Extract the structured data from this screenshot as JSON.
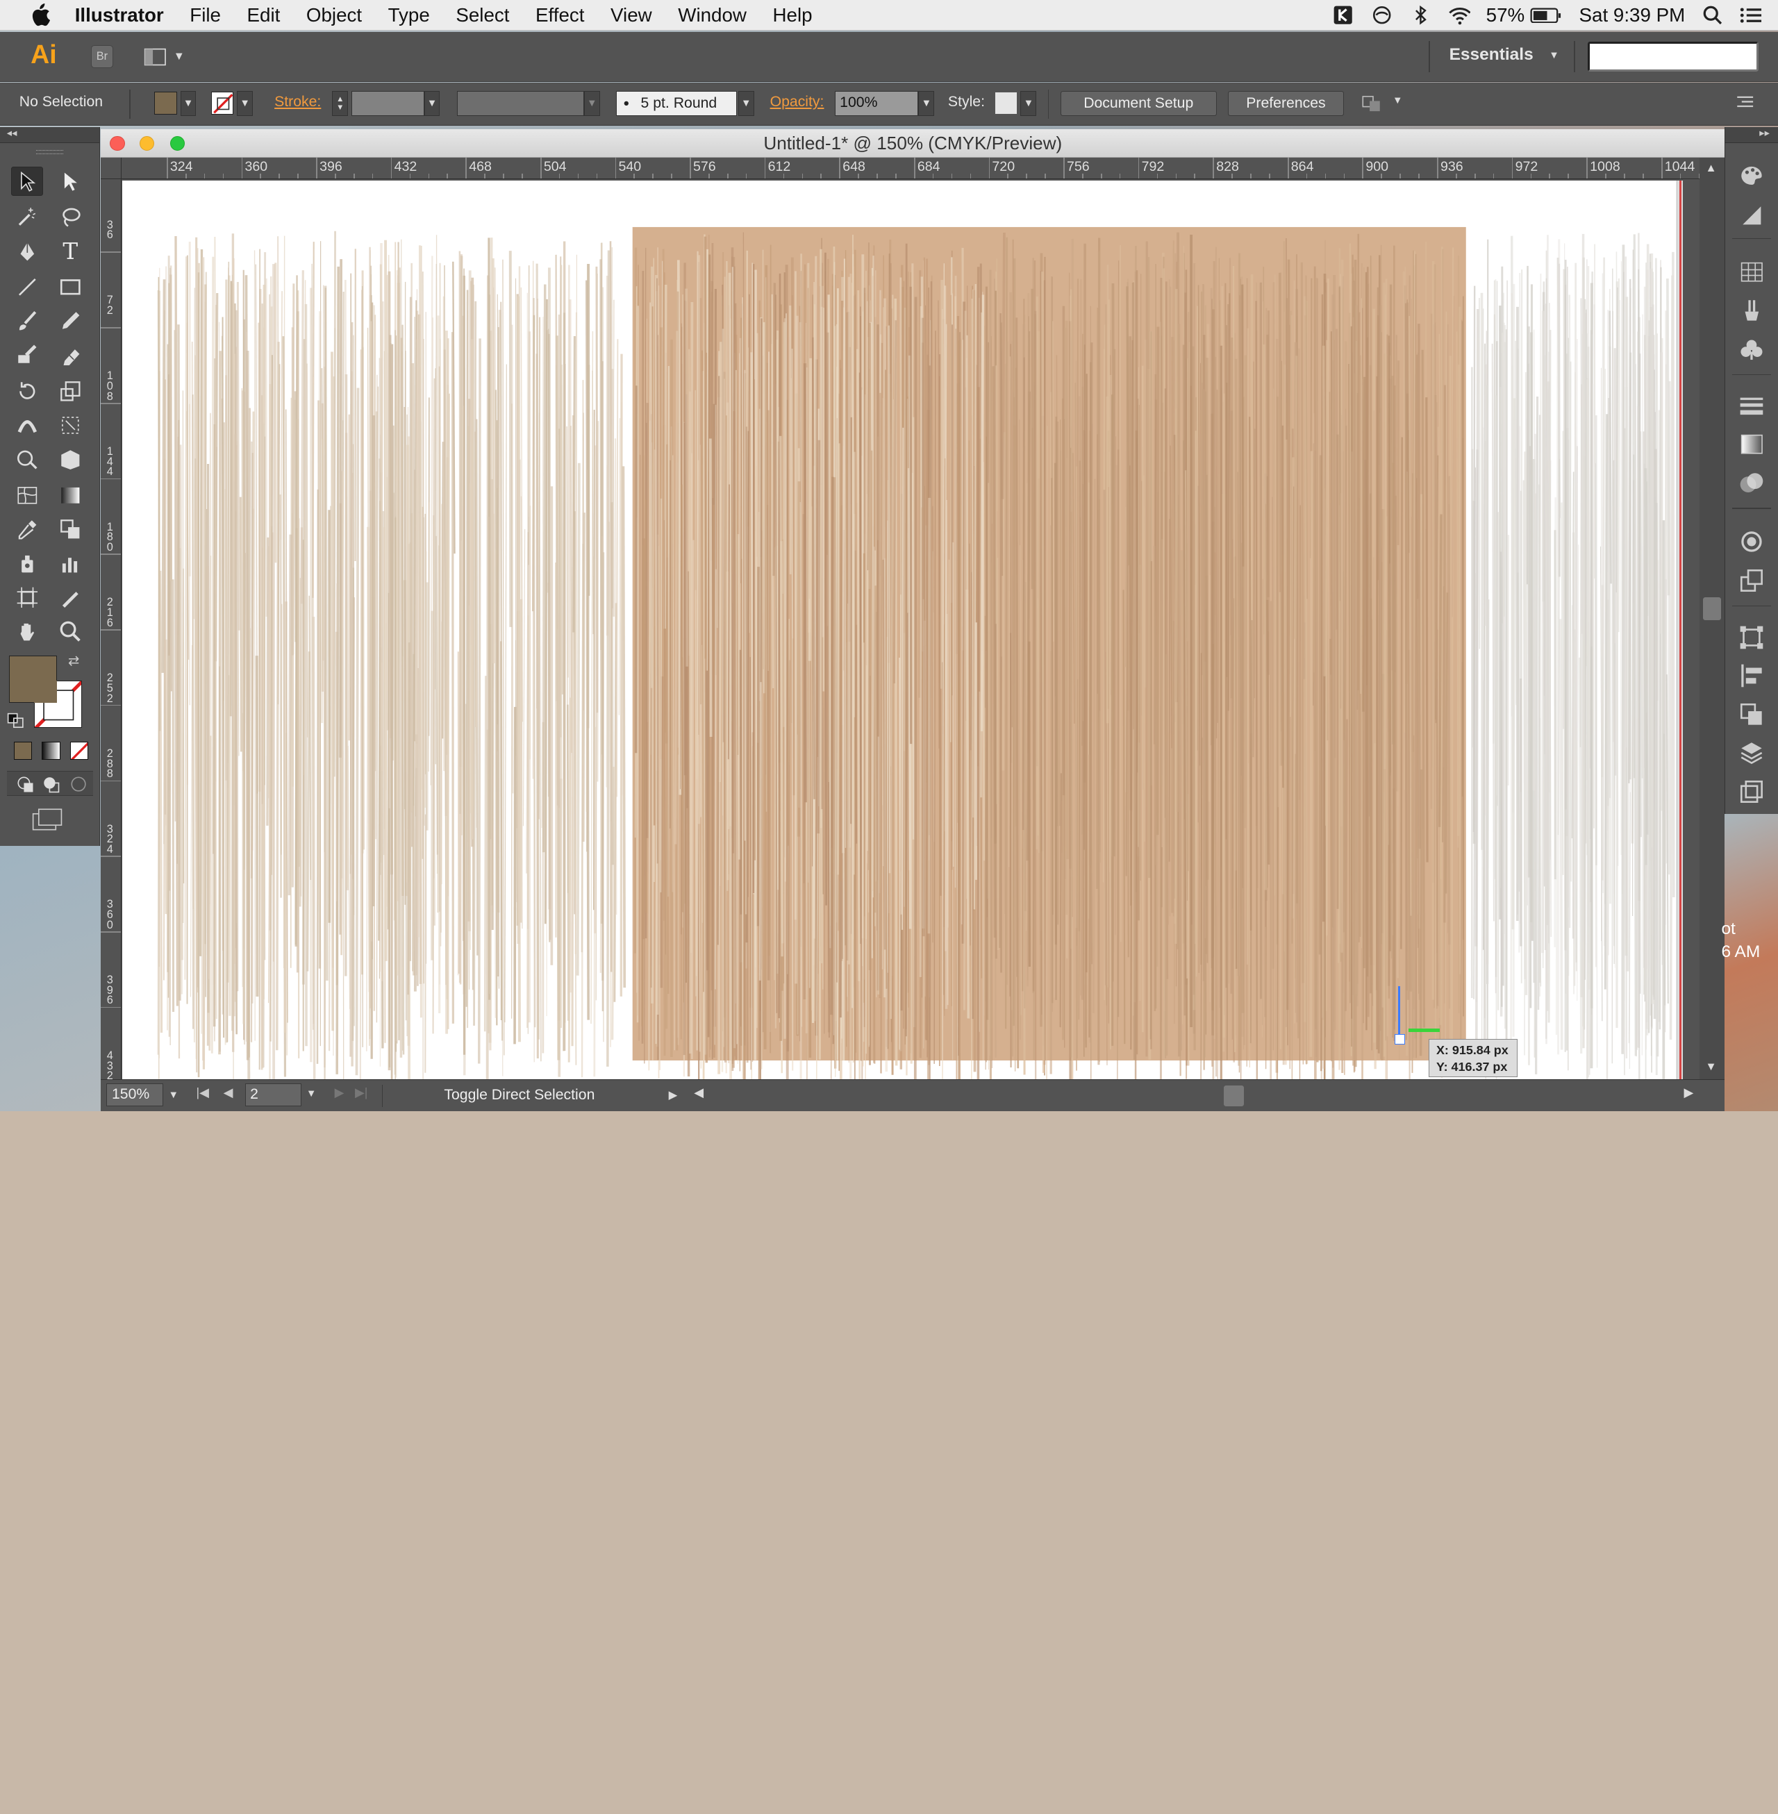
{
  "menubar": {
    "app_name": "Illustrator",
    "items": [
      "File",
      "Edit",
      "Object",
      "Type",
      "Select",
      "Effect",
      "View",
      "Window",
      "Help"
    ],
    "battery": "57%",
    "clock": "Sat 9:39 PM"
  },
  "appbar": {
    "logo": "Ai",
    "bridge": "Br",
    "workspace": "Essentials",
    "search_placeholder": ""
  },
  "control_bar": {
    "selection_status": "No Selection",
    "fill_color": "#7b6a4f",
    "stroke_label": "Stroke:",
    "brush_label": "5 pt. Round",
    "opacity_label": "Opacity:",
    "opacity_value": "100%",
    "style_label": "Style:",
    "document_setup": "Document Setup",
    "preferences": "Preferences"
  },
  "document": {
    "title": "Untitled-1* @ 150% (CMYK/Preview)",
    "ruler_h": [
      "324",
      "360",
      "396",
      "432",
      "468",
      "504",
      "540",
      "576",
      "612",
      "648",
      "684",
      "720",
      "756",
      "792",
      "828",
      "864",
      "900",
      "936",
      "972",
      "1008",
      "1044"
    ],
    "ruler_v": [
      "36",
      "72",
      "108",
      "144",
      "180",
      "216",
      "252",
      "288",
      "324",
      "360",
      "396",
      "432"
    ],
    "cursor_x": "X: 915.84 px",
    "cursor_y": "Y: 416.37 px",
    "status": {
      "zoom": "150%",
      "artboard": "2",
      "tool_hint": "Toggle Direct Selection"
    }
  },
  "colors": {
    "texture_fill": "#d5b08f",
    "texture_light": "#e2d3c0",
    "fill_swatch": "#7b6a4f",
    "ui_dark": "#535353",
    "accent_orange": "#f19a3e"
  },
  "background_fragments": {
    "line1": "ot",
    "line2": "6 AM"
  }
}
